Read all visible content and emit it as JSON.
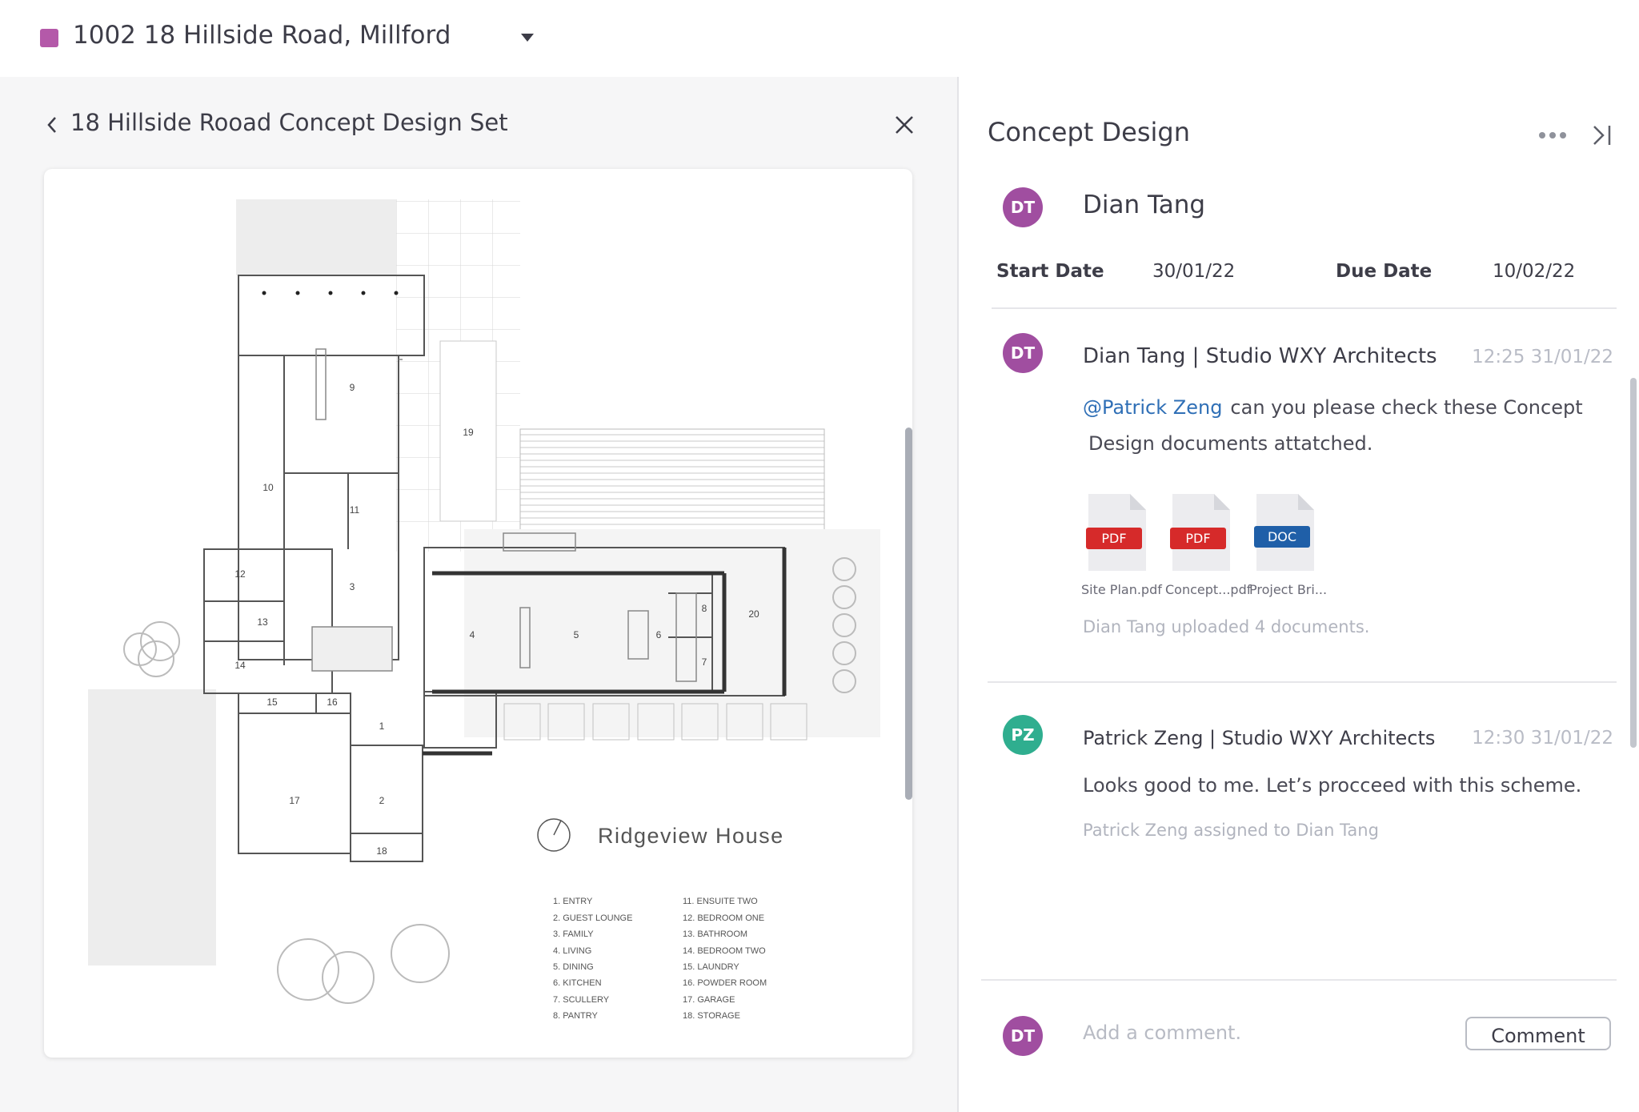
{
  "project": {
    "title": "1002 18 Hillside Road, Millford",
    "swatch_color": "#b459a9"
  },
  "viewer": {
    "set_title": "18 Hillside Rooad Concept Design Set",
    "drawing_title": "Ridgeview House",
    "room_numbers": [
      "1",
      "2",
      "3",
      "4",
      "5",
      "6",
      "7",
      "8",
      "9",
      "10",
      "11",
      "12",
      "13",
      "14",
      "15",
      "16",
      "17",
      "18",
      "19",
      "20"
    ],
    "legend_left": [
      "1. ENTRY",
      "2. GUEST LOUNGE",
      "3. FAMILY",
      "4. LIVING",
      "5. DINING",
      "6. KITCHEN",
      "7. SCULLERY",
      "8. PANTRY"
    ],
    "legend_right": [
      "11. ENSUITE TWO",
      "12. BEDROOM ONE",
      "13. BATHROOM",
      "14. BEDROOM TWO",
      "15. LAUNDRY",
      "16. POWDER ROOM",
      "17. GARAGE",
      "18. STORAGE"
    ]
  },
  "panel": {
    "title": "Concept Design",
    "assignee": {
      "initials": "DT",
      "name": "Dian Tang"
    },
    "start_label": "Start Date",
    "start_value": "30/01/22",
    "due_label": "Due Date",
    "due_value": "10/02/22"
  },
  "comments": [
    {
      "initials": "DT",
      "author": "Dian Tang | Studio WXY Architects",
      "time": "12:25 31/01/22",
      "mention": "@Patrick Zeng",
      "text_line1": "can you please check these Concept",
      "text_line2": "Design documents attatched.",
      "files": [
        {
          "type": "PDF",
          "name": "Site Plan.pdf",
          "color": "#d62a2a"
        },
        {
          "type": "PDF",
          "name": "Concept...pdf",
          "color": "#d62a2a"
        },
        {
          "type": "DOC",
          "name": "Project Bri...",
          "color": "#1f5fa8"
        }
      ],
      "activity": "Dian Tang uploaded 4 documents."
    },
    {
      "initials": "PZ",
      "author": "Patrick Zeng | Studio WXY Architects",
      "time": "12:30 31/01/22",
      "text": "Looks good to me. Let’s procceed with this scheme.",
      "activity": "Patrick Zeng assigned to Dian Tang"
    }
  ],
  "composer": {
    "initials": "DT",
    "placeholder": "Add a comment.",
    "button": "Comment"
  }
}
